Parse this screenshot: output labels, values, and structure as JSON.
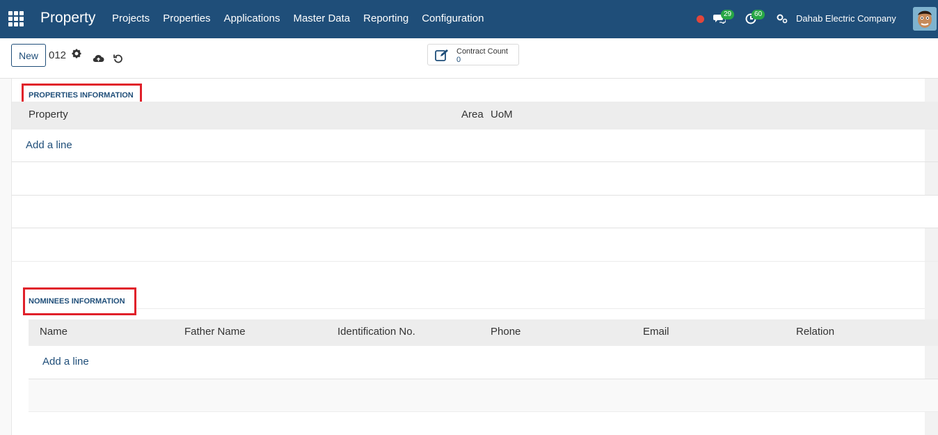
{
  "topbar": {
    "brand": "Property",
    "menu": [
      "Projects",
      "Properties",
      "Applications",
      "Master Data",
      "Reporting",
      "Configuration"
    ],
    "messages_count": "29",
    "activities_count": "60",
    "company": "Dahab Electric Company",
    "icons": [
      "apps-grid-icon",
      "chat-icon",
      "clock-icon",
      "company-switch-icon",
      "avatar"
    ]
  },
  "control_panel": {
    "new_label": "New",
    "record_name": "012",
    "stat_label": "Contract Count",
    "stat_value": "0"
  },
  "properties_section": {
    "title": "PROPERTIES INFORMATION",
    "columns": [
      "Property",
      "Area",
      "UoM"
    ],
    "add_line": "Add a line"
  },
  "nominees_section": {
    "title": "NOMINEES INFORMATION",
    "columns": [
      "Name",
      "Father Name",
      "Identification No.",
      "Phone",
      "Email",
      "Relation"
    ],
    "add_line": "Add a line"
  },
  "colors": {
    "navbar": "#1f4e79",
    "highlight": "#e0202a",
    "badge": "#28a745"
  }
}
